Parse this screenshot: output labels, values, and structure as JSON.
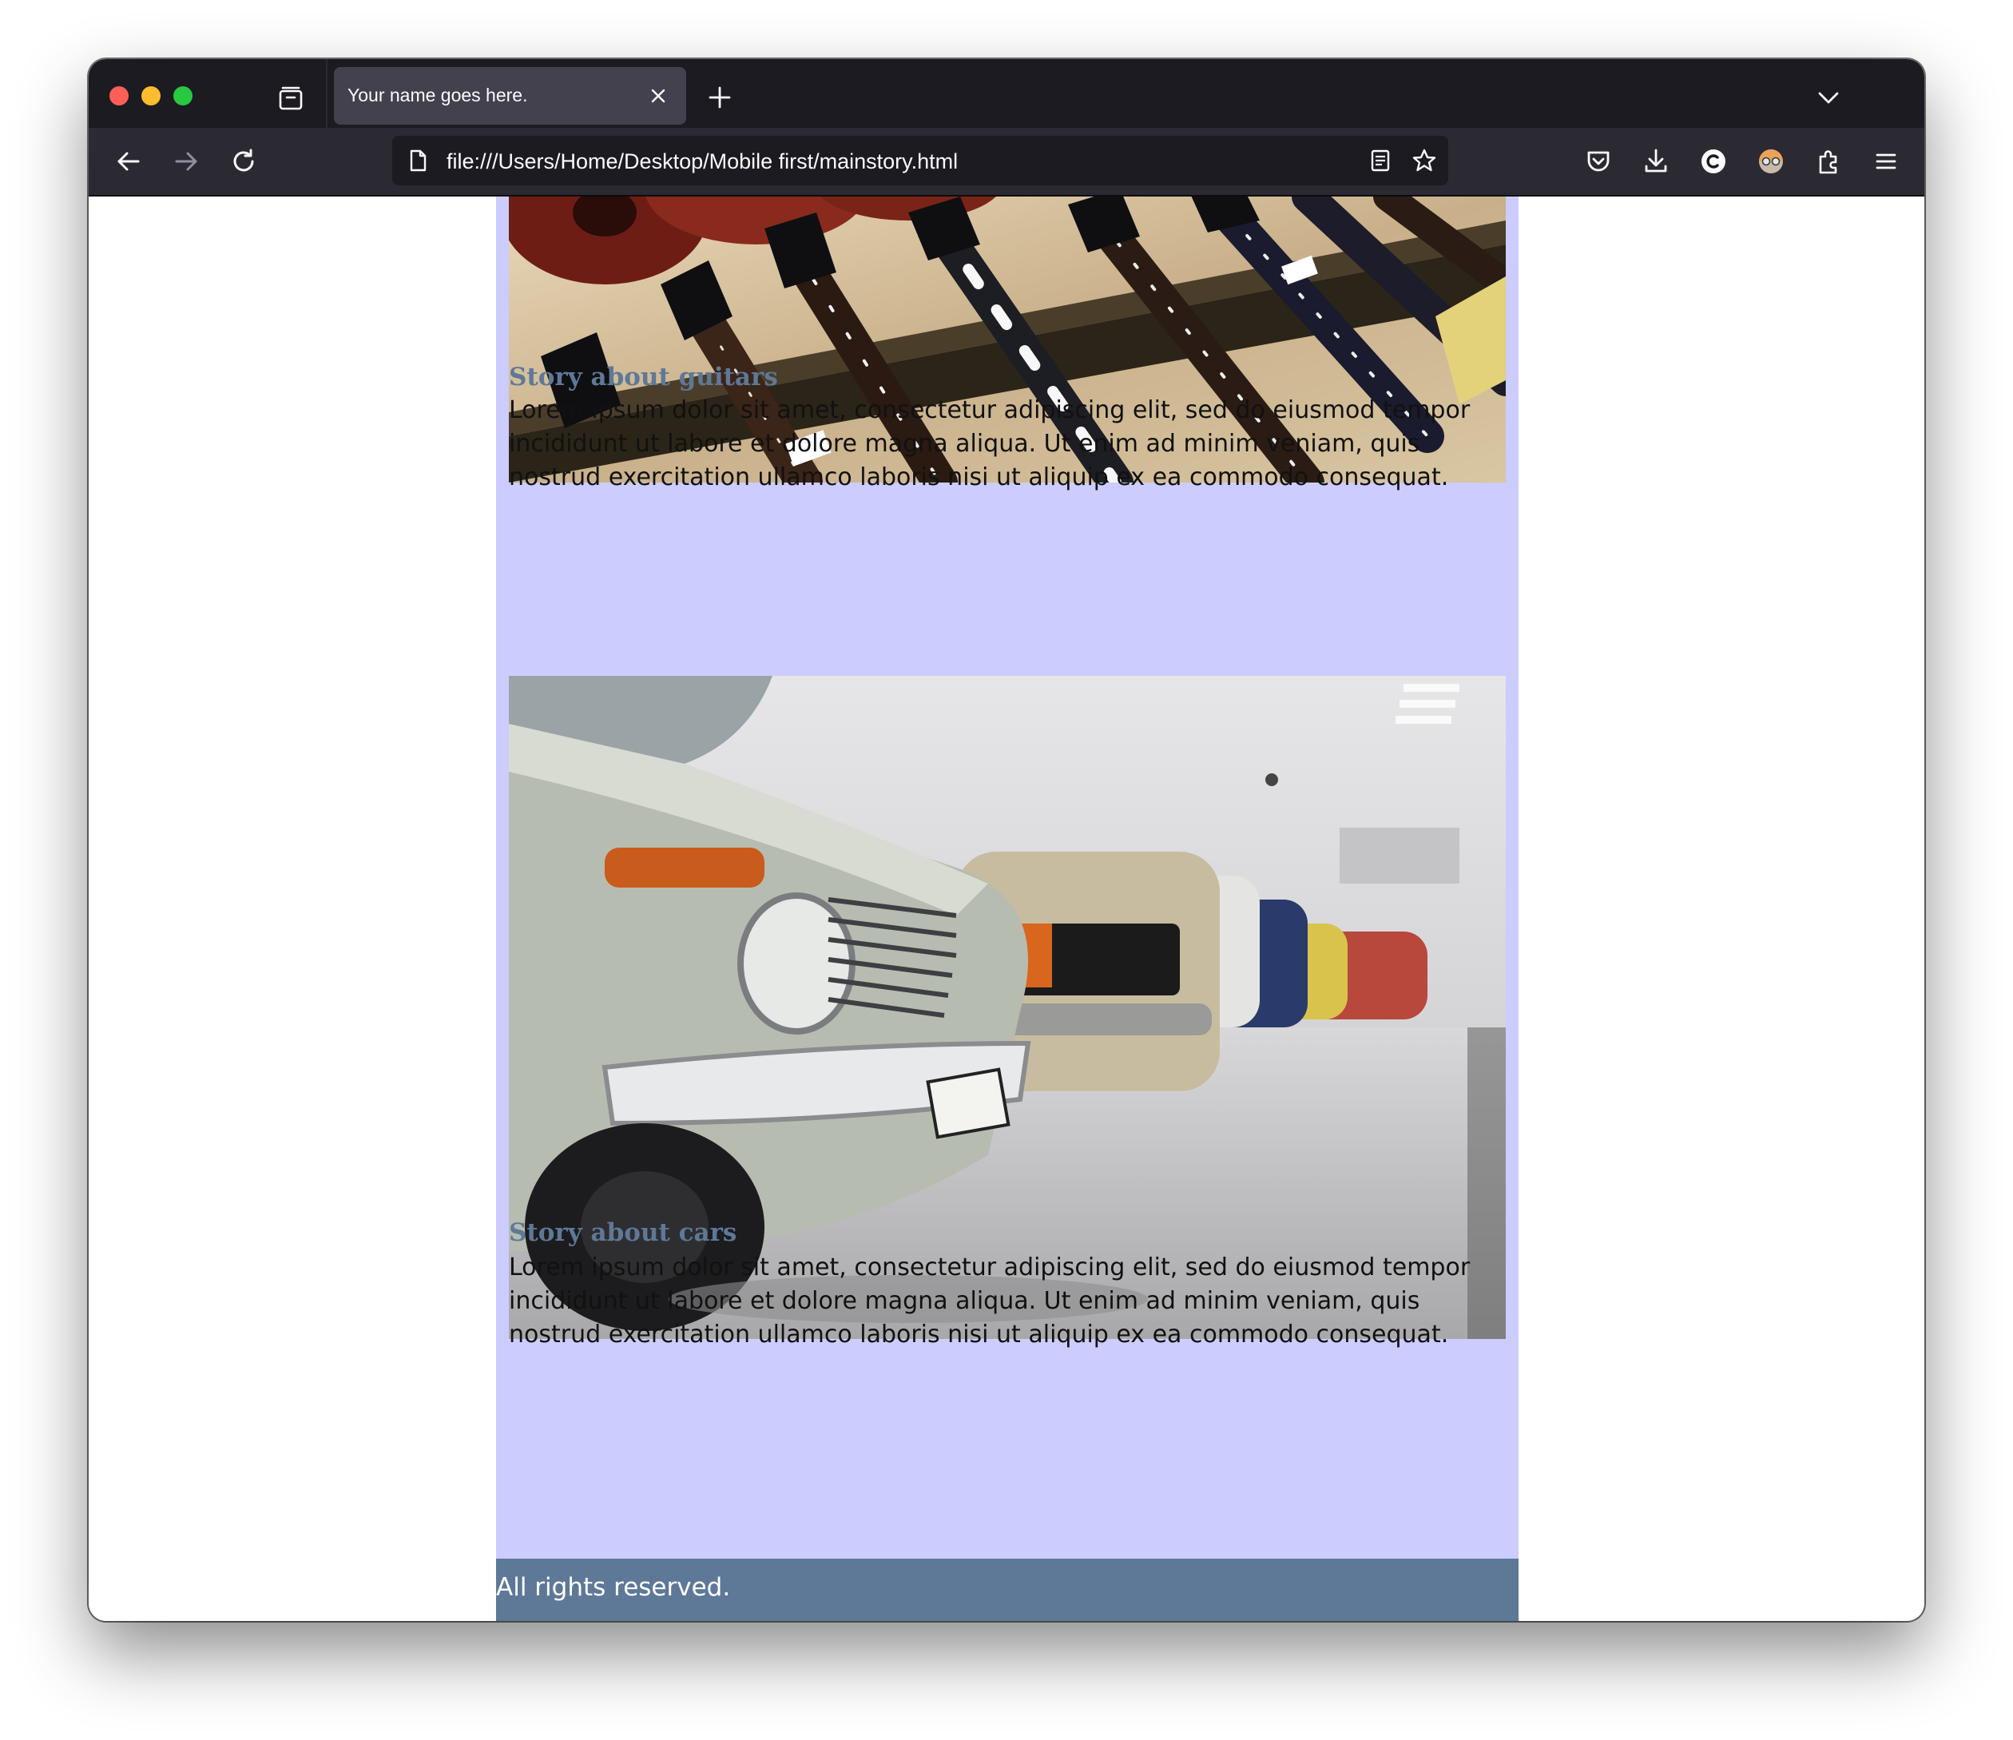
{
  "browser": {
    "tab": {
      "title": "Your name goes here."
    },
    "url": "file:///Users/Home/Desktop/Mobile first/mainstory.html",
    "icons": {
      "tabs": "tab-overview-icon",
      "close": "close-icon",
      "new_tab": "plus-icon",
      "list_tabs": "chevron-down-icon",
      "back": "back-arrow-icon",
      "forward": "forward-arrow-icon",
      "reload": "reload-icon",
      "page": "page-icon",
      "reader": "reader-view-icon",
      "bookmark": "star-icon",
      "pocket": "pocket-icon",
      "downloads": "download-icon",
      "account": "account-icon",
      "extension_avatar": "avatar-icon",
      "extensions": "puzzle-icon",
      "menu": "hamburger-menu-icon"
    }
  },
  "page": {
    "colors": {
      "column_background": "#ccccff",
      "heading": "#5e7898",
      "footer_background": "#5e7898"
    },
    "stories": [
      {
        "image": "guitars-photo",
        "title": "Story about guitars",
        "body": "Lorem ipsum dolor sit amet, consectetur adipiscing elit, sed do eiusmod tempor incididunt ut labore et dolore magna aliqua. Ut enim ad minim veniam, quis nostrud exercitation ullamco laboris nisi ut aliquip ex ea commodo consequat."
      },
      {
        "image": "cars-photo",
        "title": "Story about cars",
        "body": "Lorem ipsum dolor sit amet, consectetur adipiscing elit, sed do eiusmod tempor incididunt ut labore et dolore magna aliqua. Ut enim ad minim veniam, quis nostrud exercitation ullamco laboris nisi ut aliquip ex ea commodo consequat."
      }
    ],
    "footer": {
      "text": "All rights reserved."
    }
  }
}
